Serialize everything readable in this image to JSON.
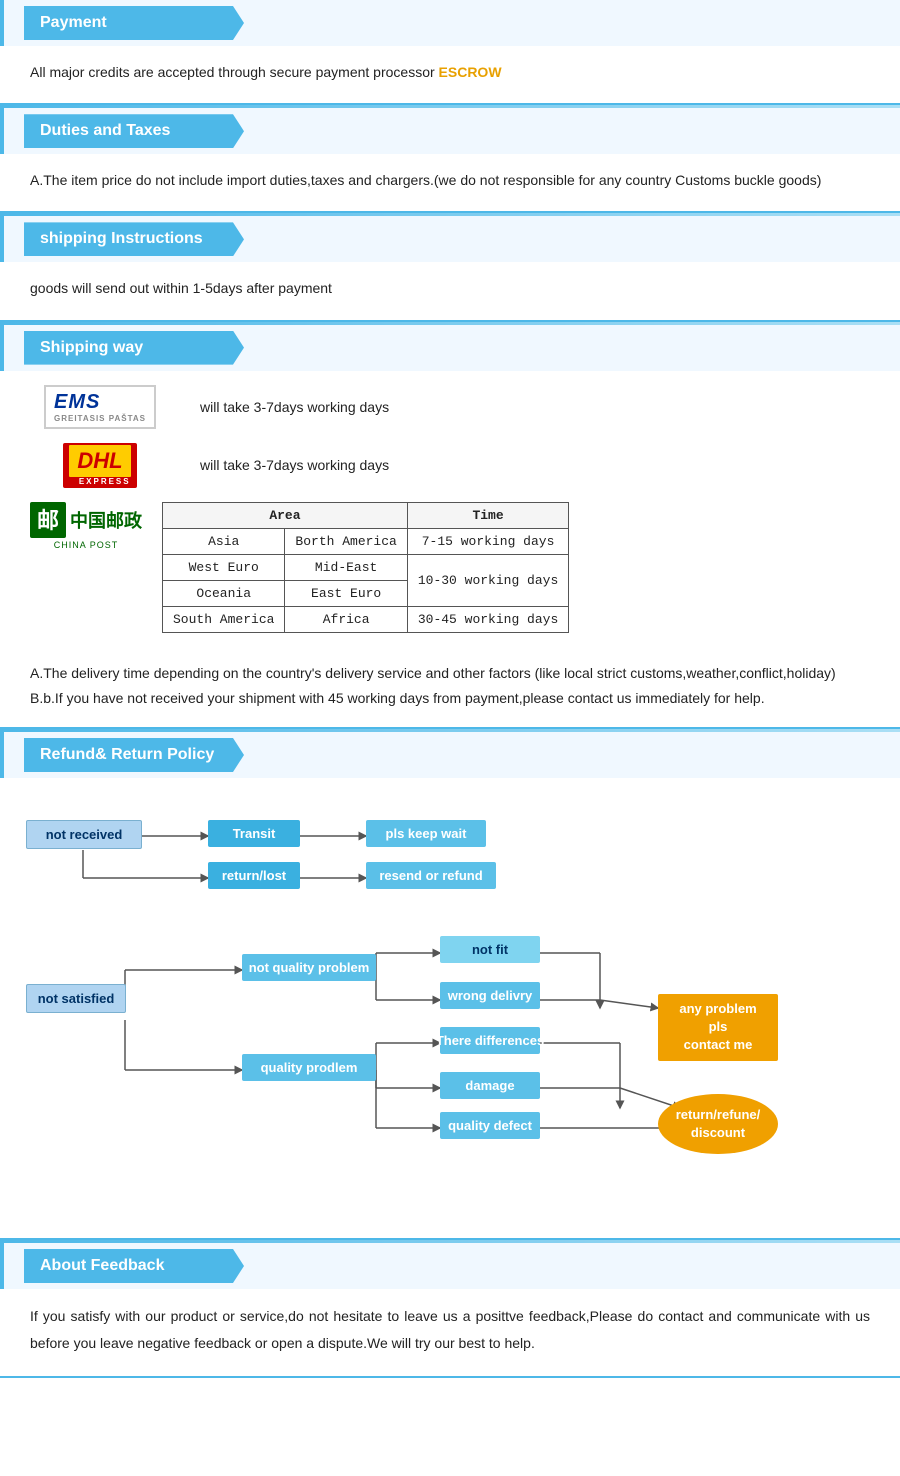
{
  "payment": {
    "header": "Payment",
    "text": "All  major  credits  are  accepted  through  secure  payment  processor ",
    "escrow": "ESCROW"
  },
  "duties": {
    "header": "Duties  and  Taxes",
    "text": "A.The  item  price  do  not  include  import  duties,taxes  and  chargers.(we  do  not  responsible  for  any  country  Customs  buckle  goods)"
  },
  "shipping_instructions": {
    "header": "shipping  Instructions",
    "text": "goods  will  send  out  within  1-5days  after  payment"
  },
  "shipping_way": {
    "header": "Shipping  way",
    "ems_text": "will  take  3-7days  working  days",
    "dhl_text": "will  take  3-7days  working  days",
    "table": {
      "headers": [
        "Area",
        "Time"
      ],
      "rows": [
        {
          "area1": "Asia",
          "area2": "Borth America",
          "time": "7-15 working days"
        },
        {
          "area1": "West Euro",
          "area2": "Mid-East",
          "time": "10-30 working days"
        },
        {
          "area1": "Oceania",
          "area2": "East Euro",
          "time": ""
        },
        {
          "area1": "South America",
          "area2": "Africa",
          "time": "30-45 working days"
        }
      ]
    },
    "note_a": "A.The  delivery  time  depending  on  the  country's  delivery  service  and  other  factors  (like  local  strict  customs,weather,conflict,holiday)",
    "note_b": "B.b.If  you  have  not  received  your  shipment  with  45  working  days  from  payment,please  contact  us  immediately  for  help."
  },
  "refund": {
    "header": "Refund&  Return  Policy",
    "boxes": {
      "not_received": "not  received",
      "transit": "Transit",
      "pls_keep_wait": "pls  keep  wait",
      "return_lost": "return/lost",
      "resend_or_refund": "resend  or  refund",
      "not_satisfied": "not  satisfied",
      "not_quality_problem": "not  quality  problem",
      "not_fit": "not  fit",
      "wrong_delivry": "wrong  delivry",
      "any_problem": "any  problem  pls\ncontact  me",
      "there_differences": "There  differences",
      "quality_prodlem": "quality  prodlem",
      "damage": "damage",
      "quality_defect": "quality  defect",
      "return_refune_discount": "return/refune/\ndiscount"
    }
  },
  "feedback": {
    "header": "About  Feedback",
    "text": "If  you  satisfy  with  our  product  or  service,do  not  hesitate  to  leave  us  a  posittve  feedback,Please  do  contact  and  communicate  with  us  before  you  leave  negative  feedback  or  open  a  dispute.We  will  try  our  best  to  help."
  }
}
